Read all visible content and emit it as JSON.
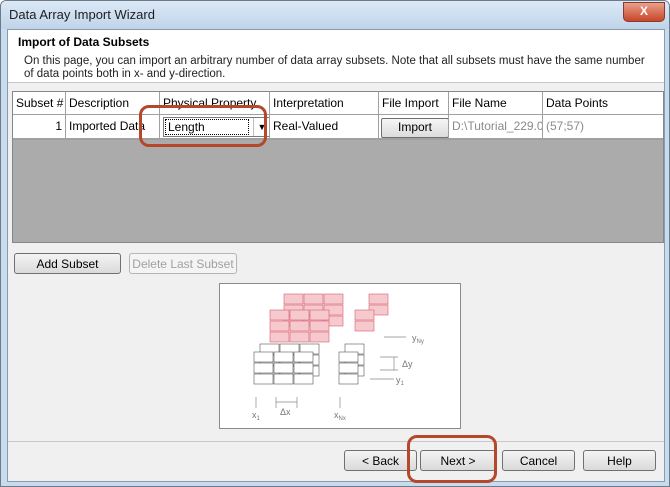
{
  "window": {
    "title": "Data Array Import Wizard",
    "close_label": "X"
  },
  "header": {
    "title": "Import of Data Subsets",
    "description": "On this page, you can import an arbitrary number of data array subsets. Note that all subsets must have the same number of data points both in x- and y-direction."
  },
  "table": {
    "columns": [
      "Subset #",
      "Description",
      "Physical Property",
      "Interpretation",
      "File Import",
      "File Name",
      "Data Points"
    ],
    "rows": [
      {
        "subset": "1",
        "description": "Imported Data",
        "property": "Length",
        "interpretation": "Real-Valued",
        "import_label": "Import",
        "file_name": "D:\\Tutorial_229.0",
        "data_points": "(57;57)"
      }
    ]
  },
  "buttons": {
    "add_subset": "Add Subset",
    "delete_last": "Delete Last Subset",
    "back": "< Back",
    "next": "Next >",
    "cancel": "Cancel",
    "help": "Help"
  },
  "diagram_labels": {
    "y_top": "y",
    "y_top_sub": "Ny",
    "dy": "Δy",
    "y1": "y",
    "y1_sub": "1",
    "x1": "x",
    "x1_sub": "1",
    "dx": "Δx",
    "xN": "x",
    "xN_sub": "Nx"
  },
  "colors": {
    "highlight": "#b5472b",
    "cell_red_fill": "#f6c9cf",
    "cell_red_stroke": "#d86070"
  }
}
